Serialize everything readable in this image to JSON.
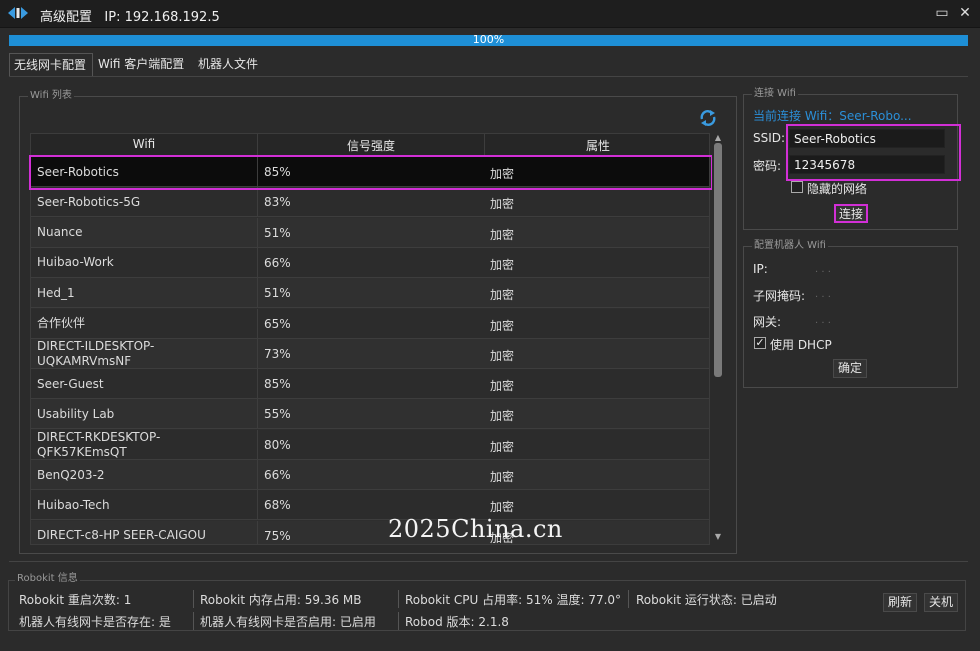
{
  "window": {
    "title": "高级配置",
    "ip_label": "IP:",
    "ip_value": "192.168.192.5",
    "maximize_glyph": "▭",
    "close_glyph": "✕"
  },
  "progress": {
    "value": 1.0,
    "label": "100%"
  },
  "tabs": [
    {
      "label": "无线网卡配置",
      "active": true
    },
    {
      "label": "Wifi 客户端配置",
      "active": false
    },
    {
      "label": "机器人文件",
      "active": false
    }
  ],
  "wifi_list": {
    "group_title": "Wifi 列表",
    "columns": [
      "Wifi",
      "信号强度",
      "属性"
    ],
    "rows": [
      {
        "ssid": "Seer-Robotics",
        "signal": "85%",
        "attr": "加密",
        "selected": true
      },
      {
        "ssid": "Seer-Robotics-5G",
        "signal": "83%",
        "attr": "加密"
      },
      {
        "ssid": "Nuance",
        "signal": "51%",
        "attr": "加密"
      },
      {
        "ssid": "Huibao-Work",
        "signal": "66%",
        "attr": "加密"
      },
      {
        "ssid": "Hed_1",
        "signal": "51%",
        "attr": "加密"
      },
      {
        "ssid": "合作伙伴",
        "signal": "65%",
        "attr": "加密"
      },
      {
        "ssid": "DIRECT-ILDESKTOP-\nUQKAMRVmsNF",
        "signal": "73%",
        "attr": "加密"
      },
      {
        "ssid": "Seer-Guest",
        "signal": "85%",
        "attr": "加密"
      },
      {
        "ssid": "Usability Lab",
        "signal": "55%",
        "attr": "加密"
      },
      {
        "ssid": "DIRECT-RKDESKTOP-\nQFK57KEmsQT",
        "signal": "80%",
        "attr": "加密"
      },
      {
        "ssid": "BenQ203-2",
        "signal": "66%",
        "attr": "加密"
      },
      {
        "ssid": "Huibao-Tech",
        "signal": "68%",
        "attr": "加密"
      },
      {
        "ssid": "DIRECT-c8-HP SEER-CAIGOU",
        "signal": "75%",
        "attr": "加密"
      }
    ]
  },
  "connect_wifi": {
    "group_title": "连接 Wifi",
    "current_label": "当前连接 Wifi：Seer-Robo...",
    "ssid_label": "SSID:",
    "ssid_value": "Seer-Robotics",
    "password_label": "密码:",
    "password_value": "12345678",
    "hidden_network_label": "隐藏的网络",
    "connect_button": "连接"
  },
  "robot_wifi": {
    "group_title": "配置机器人 Wifi",
    "ip_label": "IP:",
    "ip_value": ".        .        .",
    "mask_label": "子网掩码:",
    "mask_value": ".        .        .",
    "gateway_label": "网关:",
    "gateway_value": ".        .        .",
    "dhcp_label": "使用 DHCP",
    "dhcp_checked": true,
    "ok_button": "确定"
  },
  "robokit_info": {
    "group_title": "Robokit 信息",
    "restart_count": "Robokit 重启次数: 1",
    "memory": "Robokit 内存占用: 59.36 MB",
    "cpu": "Robokit CPU 占用率: 51% 温度: 77.0°",
    "status": "Robokit 运行状态: 已启动",
    "wired_exists": "机器人有线网卡是否存在: 是",
    "wired_enabled": "机器人有线网卡是否启用: 已启用",
    "version": "Robod 版本: 2.1.8",
    "refresh_button": "刷新",
    "shutdown_button": "关机"
  },
  "watermark": "2025China.cn",
  "colors": {
    "accent": "#1e8fd6",
    "highlight": "#d22fd6",
    "link": "#2b8fd8"
  }
}
